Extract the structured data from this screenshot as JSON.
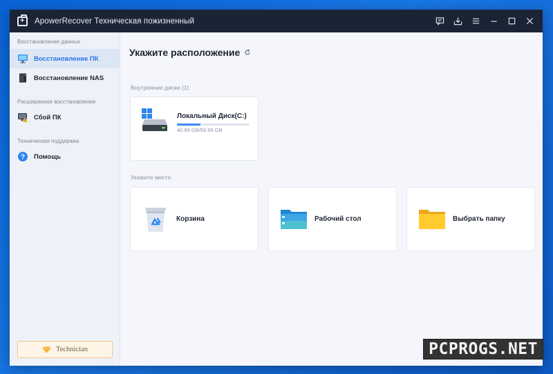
{
  "window": {
    "title": "ApowerRecover Техническая пожизненный",
    "controls": [
      "feedback-icon",
      "download-icon",
      "menu-icon",
      "minimize-icon",
      "maximize-icon",
      "close-icon"
    ]
  },
  "sidebar": {
    "sections": [
      {
        "label": "Восстановление данных",
        "items": [
          {
            "label": "Восстановление ПК",
            "icon": "monitor-icon",
            "active": true
          },
          {
            "label": "Восстановление NAS",
            "icon": "nas-icon",
            "active": false
          }
        ]
      },
      {
        "label": "Расширенное восстановление",
        "items": [
          {
            "label": "Сбой ПК",
            "icon": "pc-warning-icon",
            "active": false
          }
        ]
      },
      {
        "label": "Техническая поддержка",
        "items": [
          {
            "label": "Помощь",
            "icon": "help-icon",
            "active": false
          }
        ]
      }
    ],
    "technician_label": "Technician"
  },
  "main": {
    "title": "Укажите расположение",
    "internal_disks_label": "Внутренние диски (1)",
    "disk": {
      "name": "Локальный Диск(C:)",
      "size": "40.69 GB/59.95 GB",
      "used_fraction": 0.32
    },
    "locations_label": "Укажите место",
    "locations": [
      {
        "label": "Корзина",
        "icon": "recycle-bin-icon"
      },
      {
        "label": "Рабочий стол",
        "icon": "desktop-folder-icon"
      },
      {
        "label": "Выбрать папку",
        "icon": "folder-icon"
      }
    ]
  },
  "watermark": "PCPROGS.NET",
  "colors": {
    "accent": "#2a74e6",
    "titlebar": "#1b2434",
    "desktop": "#0a63d6"
  }
}
